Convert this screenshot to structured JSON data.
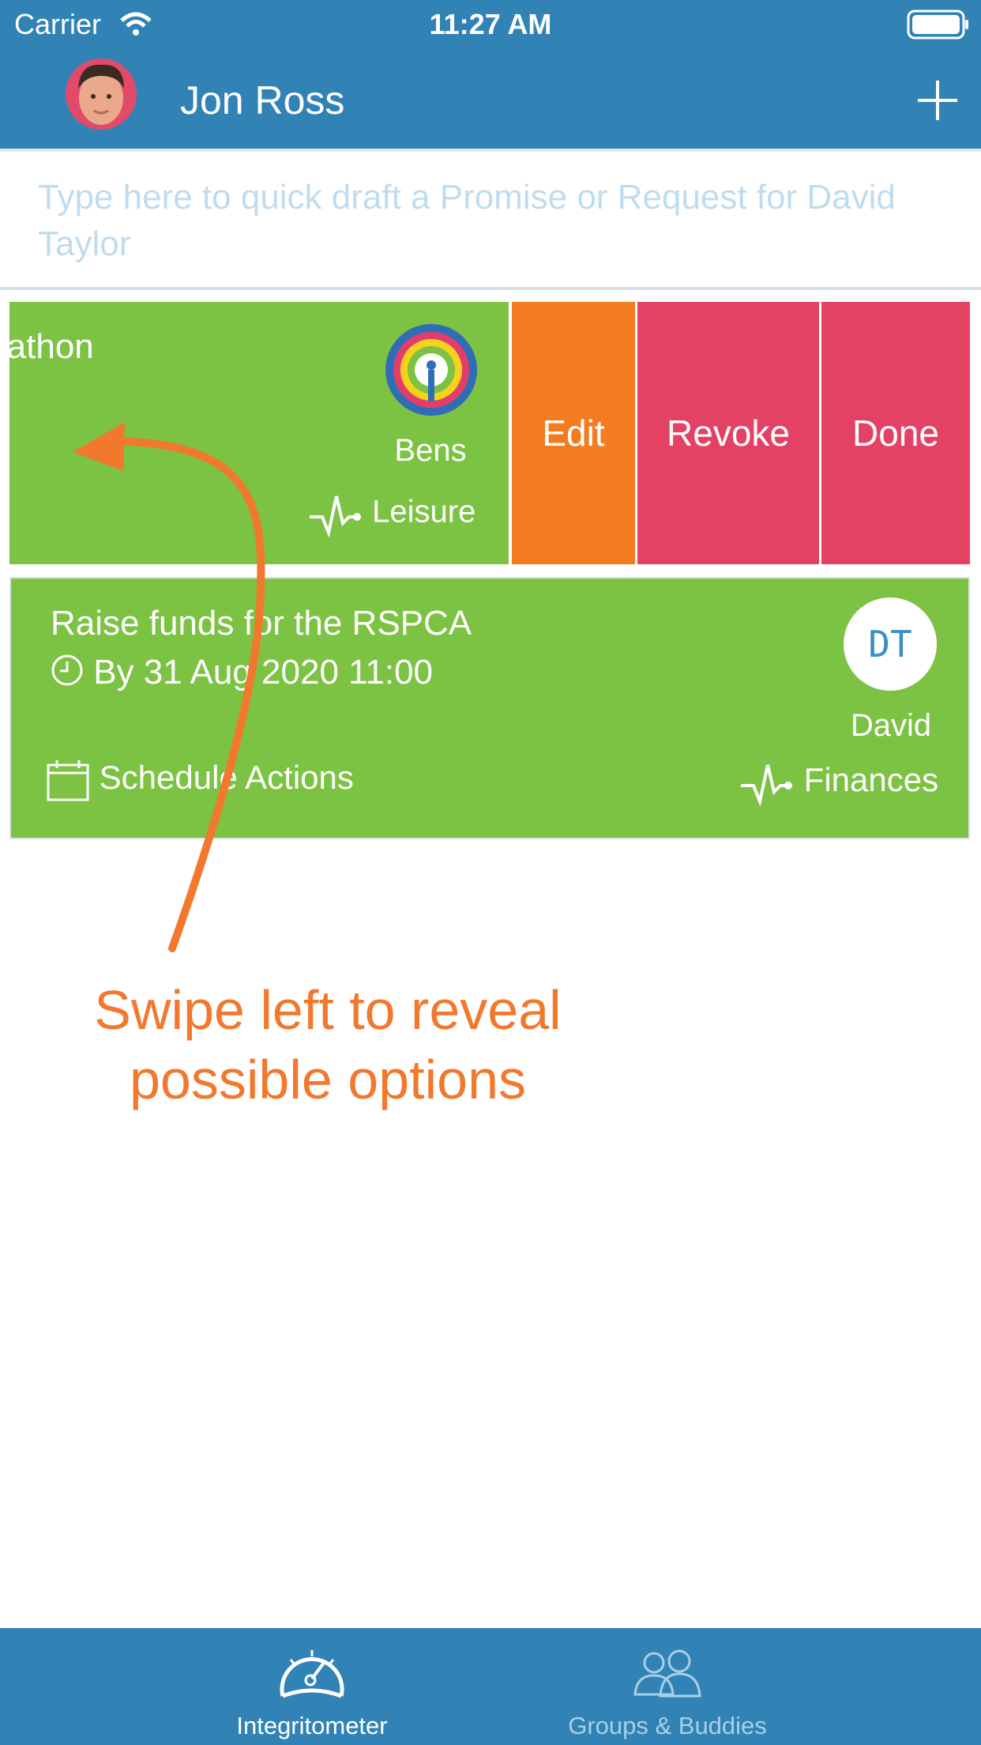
{
  "status_bar": {
    "carrier": "Carrier",
    "time": "11:27 AM"
  },
  "header": {
    "title": "Jon Ross"
  },
  "quick_draft": {
    "placeholder": "Type here to quick draft a Promise or Request for David Taylor"
  },
  "cards": [
    {
      "title_visible": "rathon",
      "subtitle_visible": ")",
      "person": "Bens",
      "category": "Leisure"
    },
    {
      "title": "Raise funds for the RSPCA",
      "due": "By 31 Aug 2020 11:00",
      "avatar_initials": "DT",
      "person": "David",
      "schedule_label": "Schedule Actions",
      "category": "Finances"
    }
  ],
  "swipe_actions": {
    "edit": "Edit",
    "revoke": "Revoke",
    "done": "Done"
  },
  "annotation": {
    "line1": "Swipe left to reveal",
    "line2": "possible options"
  },
  "tabs": [
    {
      "label": "Integritometer",
      "icon": "gauge-icon",
      "active": true
    },
    {
      "label": "Groups & Buddies",
      "icon": "people-icon",
      "active": false
    }
  ],
  "colors": {
    "header": "#3183b5",
    "card_green": "#7cc243",
    "edit_orange": "#f47c20",
    "revoke_red": "#e44265",
    "annotation_orange": "#f2782e",
    "placeholder": "#bfdcef"
  }
}
